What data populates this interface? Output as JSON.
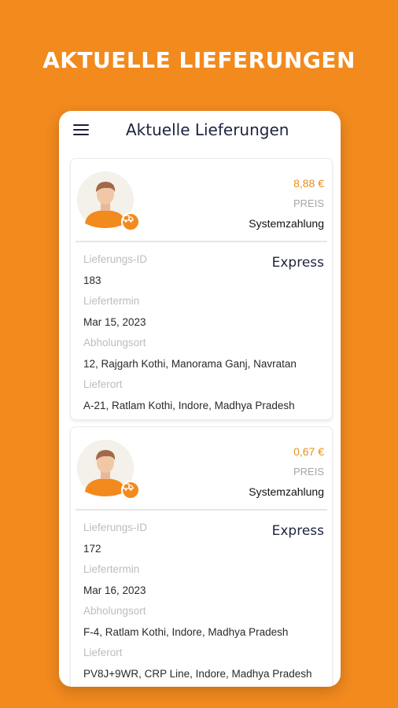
{
  "promo": {
    "title": "AKTUELLE LIEFERUNGEN"
  },
  "app_bar": {
    "title": "Aktuelle Lieferungen",
    "menu_icon": "hamburger-menu-icon"
  },
  "colors": {
    "background": "#F28A1E",
    "accent": "#E7901C",
    "title_text": "#1f2340"
  },
  "deliveries": [
    {
      "price": "8,88 €",
      "price_label": "PREIS",
      "payment": "Systemzahlung",
      "type": "Express",
      "id_label": "Lieferungs-ID",
      "id": "183",
      "date_label": "Liefertermin",
      "date": "Mar 15, 2023",
      "pickup_label": "Abholungsort",
      "pickup": "12, Rajgarh Kothi, Manorama Ganj, Navratan",
      "dropoff_label": "Lieferort",
      "dropoff": "A-21, Ratlam Kothi, Indore, Madhya Pradesh"
    },
    {
      "price": "0,67 €",
      "price_label": "PREIS",
      "payment": "Systemzahlung",
      "type": "Express",
      "id_label": "Lieferungs-ID",
      "id": "172",
      "date_label": "Liefertermin",
      "date": "Mar 16, 2023",
      "pickup_label": "Abholungsort",
      "pickup": "F-4, Ratlam Kothi, Indore, Madhya Pradesh",
      "dropoff_label": "Lieferort",
      "dropoff": "PV8J+9WR, CRP Line, Indore, Madhya Pradesh"
    }
  ]
}
